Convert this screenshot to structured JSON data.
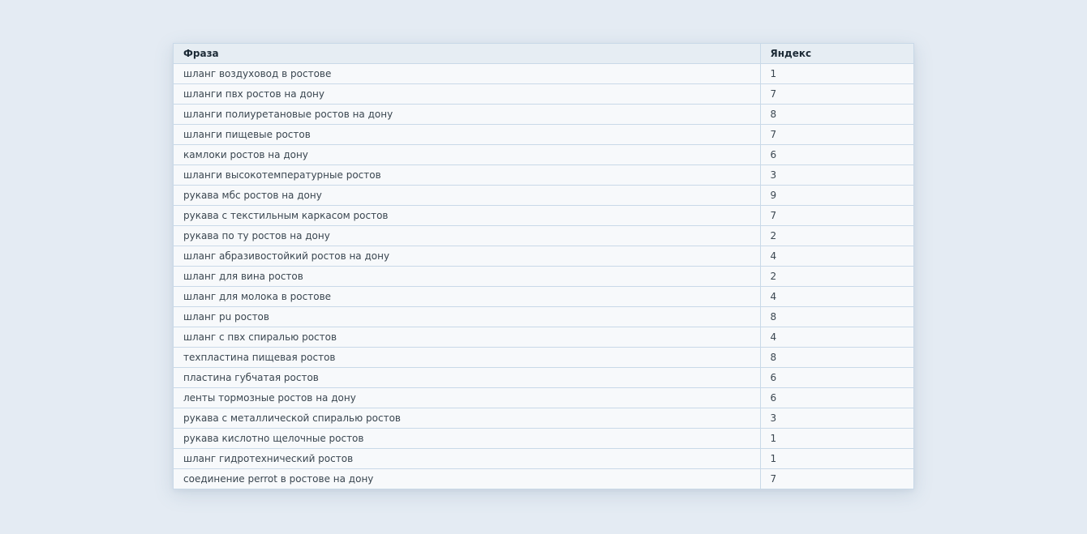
{
  "table": {
    "columns": [
      "Фраза",
      "Яндекс"
    ],
    "rows": [
      {
        "phrase": "шланг воздуховод в ростове",
        "yandex": "1"
      },
      {
        "phrase": "шланги пвх ростов на дону",
        "yandex": "7"
      },
      {
        "phrase": "шланги полиуретановые ростов на дону",
        "yandex": "8"
      },
      {
        "phrase": "шланги пищевые ростов",
        "yandex": "7"
      },
      {
        "phrase": "камлоки ростов на дону",
        "yandex": "6"
      },
      {
        "phrase": "шланги высокотемпературные ростов",
        "yandex": "3"
      },
      {
        "phrase": "рукава мбс ростов на дону",
        "yandex": "9"
      },
      {
        "phrase": "рукава с текстильным каркасом ростов",
        "yandex": "7"
      },
      {
        "phrase": "рукава по ту ростов на дону",
        "yandex": "2"
      },
      {
        "phrase": "шланг абразивостойкий ростов на дону",
        "yandex": "4"
      },
      {
        "phrase": "шланг для вина ростов",
        "yandex": "2"
      },
      {
        "phrase": "шланг для молока в ростове",
        "yandex": "4"
      },
      {
        "phrase": "шланг pu ростов",
        "yandex": "8"
      },
      {
        "phrase": "шланг с пвх спиралью ростов",
        "yandex": "4"
      },
      {
        "phrase": "техпластина пищевая ростов",
        "yandex": "8"
      },
      {
        "phrase": "пластина губчатая ростов",
        "yandex": "6"
      },
      {
        "phrase": "ленты тормозные ростов на дону",
        "yandex": "6"
      },
      {
        "phrase": "рукава с металлической спиралью ростов",
        "yandex": "3"
      },
      {
        "phrase": "рукава кислотно щелочные ростов",
        "yandex": "1"
      },
      {
        "phrase": "шланг гидротехнический ростов",
        "yandex": "1"
      },
      {
        "phrase": "соединение perrot в ростове на дону",
        "yandex": "7"
      }
    ]
  }
}
